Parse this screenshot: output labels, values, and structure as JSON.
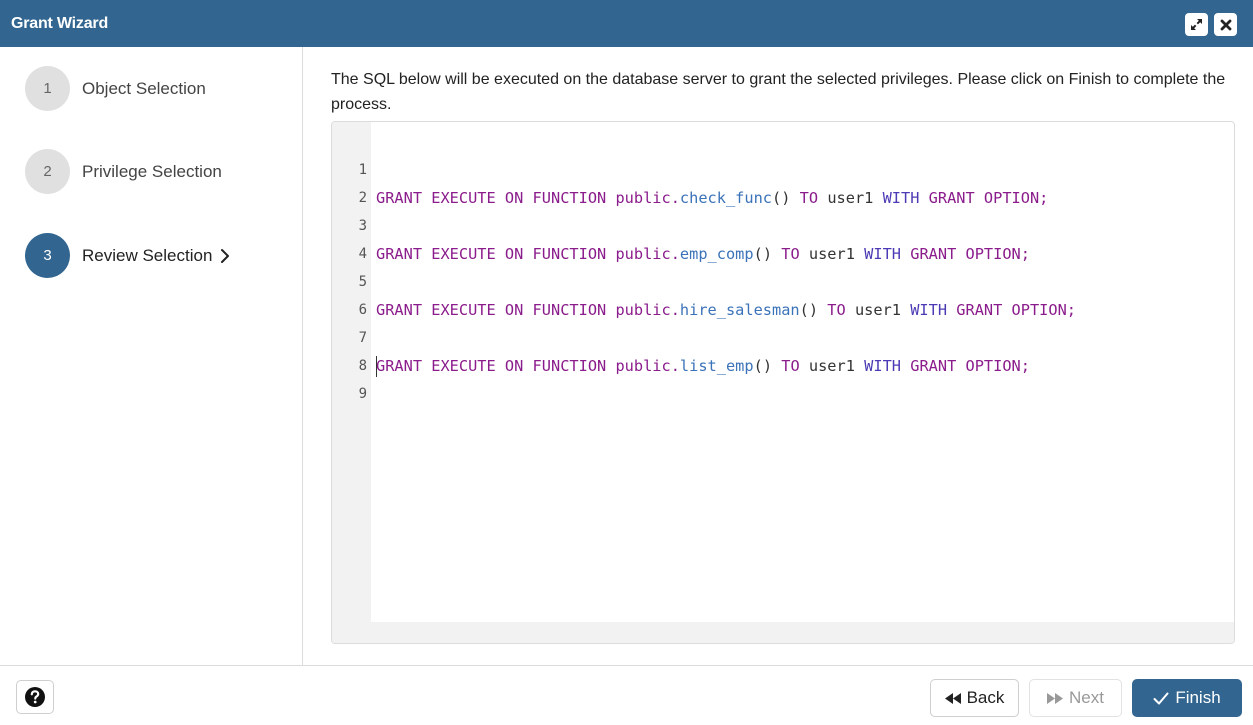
{
  "window": {
    "title": "Grant Wizard",
    "maximize_icon": "expand-icon",
    "close_icon": "close-icon"
  },
  "steps": [
    {
      "number": "1",
      "label": "Object Selection",
      "active": false
    },
    {
      "number": "2",
      "label": "Privilege Selection",
      "active": false
    },
    {
      "number": "3",
      "label": "Review Selection",
      "active": true
    }
  ],
  "instructions": "The SQL below will be executed on the database server to grant the selected privileges. Please click on Finish to complete the process.",
  "editor": {
    "line_numbers": [
      "1",
      "2",
      "3",
      "4",
      "5",
      "6",
      "7",
      "8",
      "9"
    ],
    "lines": [
      {
        "kw1": "GRANT EXECUTE ON FUNCTION public.",
        "func": "check_func",
        "paren": "()",
        "to": "TO",
        "user": "user1",
        "with": "WITH",
        "tail": "GRANT OPTION;"
      },
      {
        "kw1": "GRANT EXECUTE ON FUNCTION public.",
        "func": "emp_comp",
        "paren": "()",
        "to": "TO",
        "user": "user1",
        "with": "WITH",
        "tail": "GRANT OPTION;"
      },
      {
        "kw1": "GRANT EXECUTE ON FUNCTION public.",
        "func": "hire_salesman",
        "paren": "()",
        "to": "TO",
        "user": "user1",
        "with": "WITH",
        "tail": "GRANT OPTION;"
      },
      {
        "kw1": "GRANT EXECUTE ON FUNCTION public.",
        "func": "list_emp",
        "paren": "()",
        "to": "TO",
        "user": "user1",
        "with": "WITH",
        "tail": "GRANT OPTION;"
      }
    ]
  },
  "footer": {
    "help_icon": "help-icon",
    "back_label": "Back",
    "next_label": "Next",
    "finish_label": "Finish"
  },
  "colors": {
    "primary": "#326690",
    "keyword": "#8b1c8c",
    "function": "#3b73b9"
  }
}
